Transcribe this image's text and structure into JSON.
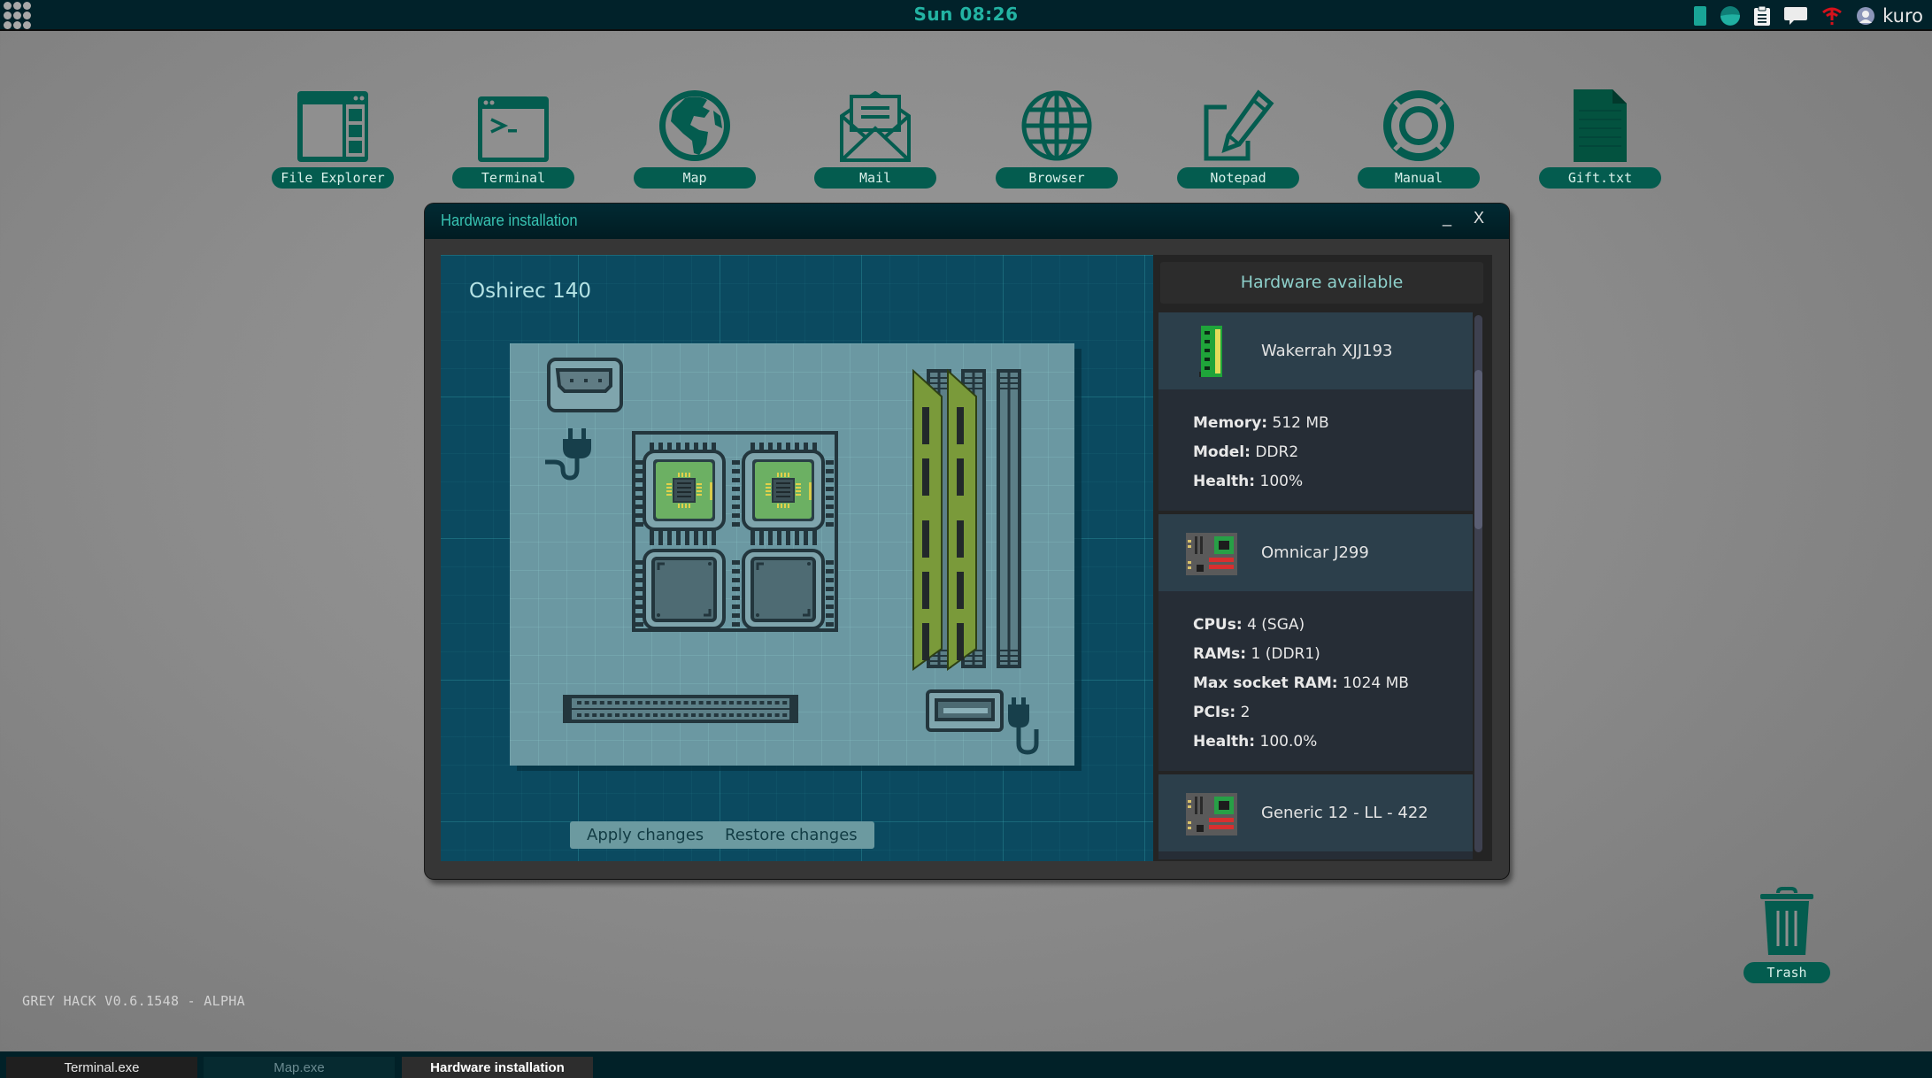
{
  "topbar": {
    "clock": "Sun 08:26",
    "user": "kuro",
    "tray_icons": [
      "battery-icon",
      "disk-icon",
      "clipboard-icon",
      "chat-icon",
      "wifi-disconnected-icon",
      "user-icon"
    ]
  },
  "desktop": {
    "icons": [
      {
        "label": "File Explorer",
        "icon": "file-explorer-icon"
      },
      {
        "label": "Terminal",
        "icon": "terminal-icon"
      },
      {
        "label": "Map",
        "icon": "globe-map-icon"
      },
      {
        "label": "Mail",
        "icon": "mail-icon"
      },
      {
        "label": "Browser",
        "icon": "browser-icon"
      },
      {
        "label": "Notepad",
        "icon": "notepad-icon"
      },
      {
        "label": "Manual",
        "icon": "lifebuoy-icon"
      },
      {
        "label": "Gift.txt",
        "icon": "text-file-icon"
      }
    ],
    "trash": {
      "label": "Trash",
      "icon": "trash-icon"
    },
    "version": "GREY HACK V0.6.1548 - ALPHA"
  },
  "window": {
    "title": "Hardware installation",
    "minimize_label": "_",
    "close_label": "X",
    "board": {
      "name": "Oshirec 140",
      "cpu_sockets": 4,
      "cpus_installed": 2,
      "ram_slots": 3,
      "rams_installed": 2
    },
    "apply_label": "Apply changes",
    "restore_label": "Restore changes",
    "hardware_panel": {
      "header": "Hardware available",
      "items": [
        {
          "name": "Wakerrah XJJ193",
          "icon": "ram-module-icon",
          "specs": [
            {
              "key": "Memory:",
              "value": "512 MB"
            },
            {
              "key": "Model:",
              "value": "DDR2"
            },
            {
              "key": "Health:",
              "value": "100%"
            }
          ]
        },
        {
          "name": "Omnicar J299",
          "icon": "motherboard-icon",
          "specs": [
            {
              "key": "CPUs:",
              "value": "4 (SGA)"
            },
            {
              "key": "RAMs:",
              "value": "1 (DDR1)"
            },
            {
              "key": "Max socket RAM:",
              "value": "1024 MB"
            },
            {
              "key": "PCIs:",
              "value": "2"
            },
            {
              "key": "Health:",
              "value": "100.0%"
            }
          ]
        },
        {
          "name": "Generic 12 - LL - 422",
          "icon": "motherboard-icon",
          "specs": []
        }
      ]
    }
  },
  "taskbar": {
    "tasks": [
      {
        "label": "Terminal.exe"
      },
      {
        "label": "Map.exe"
      },
      {
        "label": "Hardware installation",
        "active": true
      }
    ]
  },
  "colors": {
    "accent": "#23b3a3",
    "icon_green": "#045c4f",
    "topbar_bg": "#01222a",
    "board_bg": "#0b4a60",
    "motherboard_bg": "#6b98a2"
  }
}
